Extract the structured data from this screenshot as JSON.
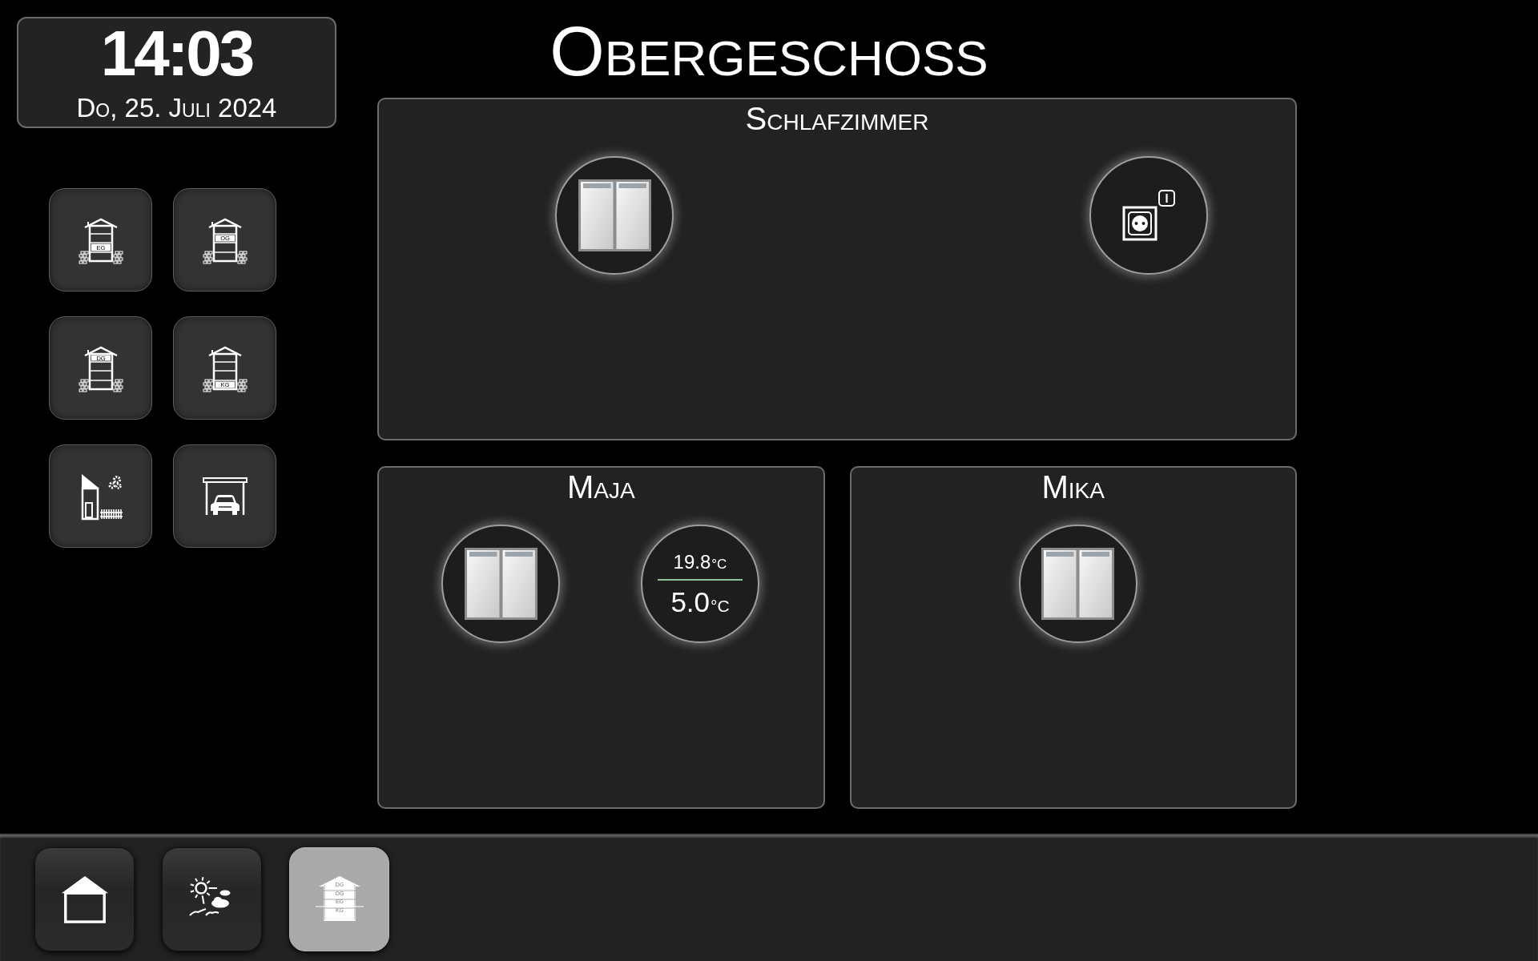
{
  "clock": {
    "time": "14:03",
    "date": "Do, 25. Juli 2024"
  },
  "side_nav": [
    {
      "kind": "ground_floor",
      "label": "EG"
    },
    {
      "kind": "upper_floor",
      "label": "OG"
    },
    {
      "kind": "attic",
      "label": "DG"
    },
    {
      "kind": "basement",
      "label": "KG"
    },
    {
      "kind": "garden"
    },
    {
      "kind": "garage"
    }
  ],
  "title": "Obergeschoss",
  "rooms": [
    {
      "name": "Schlafzimmer",
      "widgets": [
        {
          "kind": "window"
        },
        {
          "kind": "socket",
          "on": true
        }
      ]
    },
    {
      "name": "Maja",
      "widgets": [
        {
          "kind": "window"
        },
        {
          "kind": "thermostat",
          "temperature": "19.8",
          "temperature_unit": "°C",
          "setpoint": "5.0",
          "setpoint_unit": "°C"
        }
      ]
    },
    {
      "name": "Mika",
      "widgets": [
        {
          "kind": "window"
        }
      ]
    }
  ],
  "bottom_bar": [
    {
      "kind": "home",
      "selected": false
    },
    {
      "kind": "weather",
      "selected": false
    },
    {
      "kind": "floors",
      "selected": true,
      "labels": [
        "DG",
        "OG",
        "EG",
        "KG"
      ]
    }
  ]
}
